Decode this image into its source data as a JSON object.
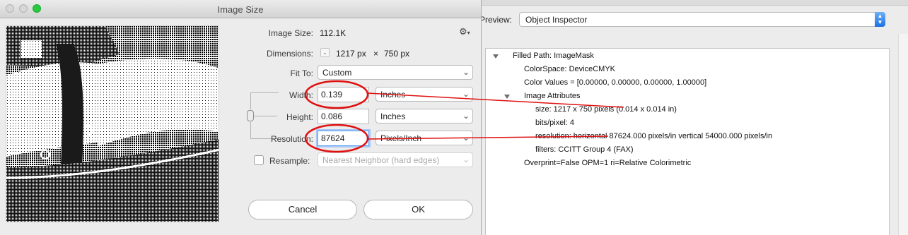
{
  "preflight": {
    "preview_label": "Preview:",
    "preview_value": "Object Inspector",
    "tree": [
      {
        "text": "Filled Path: ImageMask",
        "level": 0,
        "expanded": true
      },
      {
        "text": "ColorSpace: DeviceCMYK",
        "level": 1
      },
      {
        "text": "Color Values = [0.00000, 0.00000, 0.00000, 1.00000]",
        "level": 1
      },
      {
        "text": "Image Attributes",
        "level": 1,
        "expanded": true
      },
      {
        "text": "size: 1217 x 750 pixels (0.014 x 0.014 in)",
        "level": 2
      },
      {
        "text": "bits/pixel: 4",
        "level": 2
      },
      {
        "text": "resolution: horizontal 87624.000 pixels/in vertical 54000.000 pixels/in",
        "level": 2
      },
      {
        "text": "filters: CCITT Group 4 (FAX)",
        "level": 2
      },
      {
        "text": "Overprint=False OPM=1 ri=Relative Colorimetric",
        "level": 1
      }
    ]
  },
  "dialog": {
    "title": "Image Size",
    "image_size_label": "Image Size:",
    "image_size_value": "112.1K",
    "gear_icon": "gear-icon",
    "dimensions_label": "Dimensions:",
    "dimensions_w": "1217 px",
    "dimensions_x": "×",
    "dimensions_h": "750 px",
    "fit_to_label": "Fit To:",
    "fit_to_value": "Custom",
    "width_label": "Width:",
    "width_value": "0.139",
    "width_unit": "Inches",
    "height_label": "Height:",
    "height_value": "0.086",
    "height_unit": "Inches",
    "resolution_label": "Resolution:",
    "resolution_value": "87624",
    "resolution_unit": "Pixels/Inch",
    "resample_label": "Resample:",
    "resample_checked": false,
    "resample_value": "Nearest Neighbor (hard edges)",
    "cancel_label": "Cancel",
    "ok_label": "OK"
  },
  "colors": {
    "annotation": "#e01010",
    "focus": "#5a9cf2",
    "stepper": "#1a70e6",
    "traffic_close": "#d7d7d7",
    "traffic_min": "#d7d7d7",
    "traffic_zoom": "#27c93f"
  }
}
